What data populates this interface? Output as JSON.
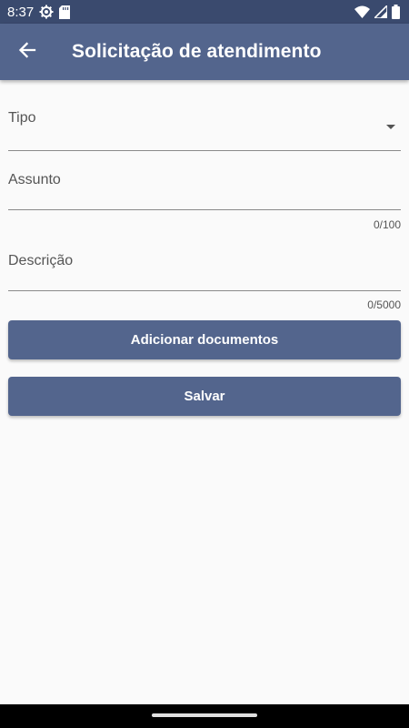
{
  "status_bar": {
    "time": "8:37",
    "icons": [
      "settings-icon",
      "sd-card-icon",
      "wifi-icon",
      "signal-icon",
      "battery-icon"
    ]
  },
  "app_bar": {
    "back_icon": "arrow-left-icon",
    "title": "Solicitação de atendimento"
  },
  "form": {
    "tipo": {
      "label": "Tipo",
      "value": ""
    },
    "assunto": {
      "label": "Assunto",
      "value": "",
      "counter": "0/100"
    },
    "descricao": {
      "label": "Descrição",
      "value": "",
      "counter": "0/5000"
    }
  },
  "buttons": {
    "add_documents": "Adicionar documentos",
    "save": "Salvar"
  },
  "colors": {
    "primary": "#53658d",
    "status_bar": "#3a4a6e",
    "background": "#fafafa"
  }
}
